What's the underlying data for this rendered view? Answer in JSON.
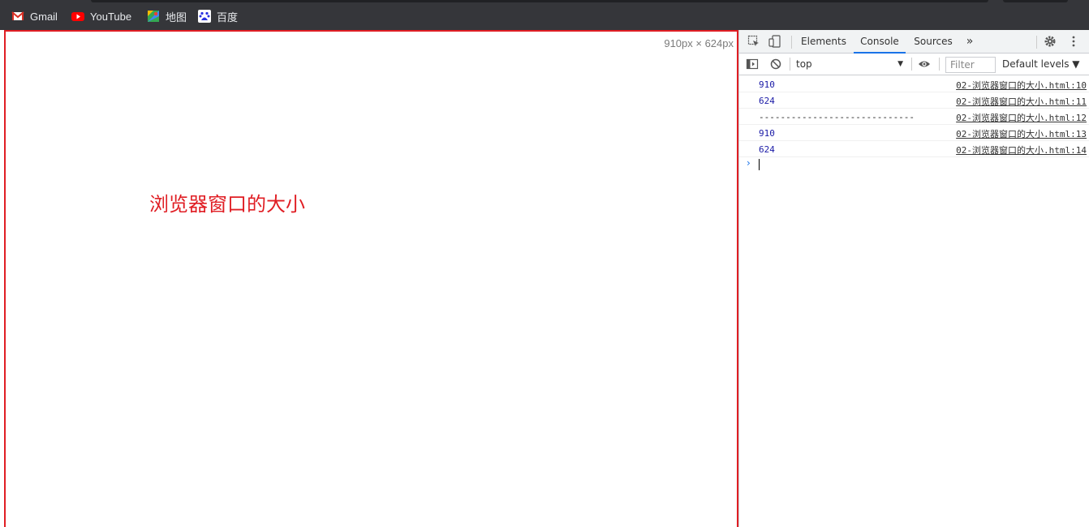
{
  "bookmarks": [
    {
      "label": "Gmail",
      "icon": "gmail-icon"
    },
    {
      "label": "YouTube",
      "icon": "youtube-icon"
    },
    {
      "label": "地图",
      "icon": "maps-icon"
    },
    {
      "label": "百度",
      "icon": "baidu-icon"
    }
  ],
  "page": {
    "size_overlay": "910px × 624px",
    "heading": "浏览器窗口的大小"
  },
  "devtools": {
    "tabs": [
      "Elements",
      "Console",
      "Sources"
    ],
    "active_tab": "Console",
    "more_tabs": "»",
    "context": "top",
    "filter_placeholder": "Filter",
    "levels": "Default levels ▼",
    "logs": [
      {
        "message": "910",
        "source": "02-浏览器窗口的大小.html:10"
      },
      {
        "message": "624",
        "source": "02-浏览器窗口的大小.html:11"
      },
      {
        "message": "-----------------------------",
        "source": "02-浏览器窗口的大小.html:12"
      },
      {
        "message": "910",
        "source": "02-浏览器窗口的大小.html:13"
      },
      {
        "message": "624",
        "source": "02-浏览器窗口的大小.html:14"
      }
    ],
    "prompt": "›"
  },
  "colors": {
    "accent": "#e01e24",
    "devtools_blue": "#1a73e8"
  }
}
